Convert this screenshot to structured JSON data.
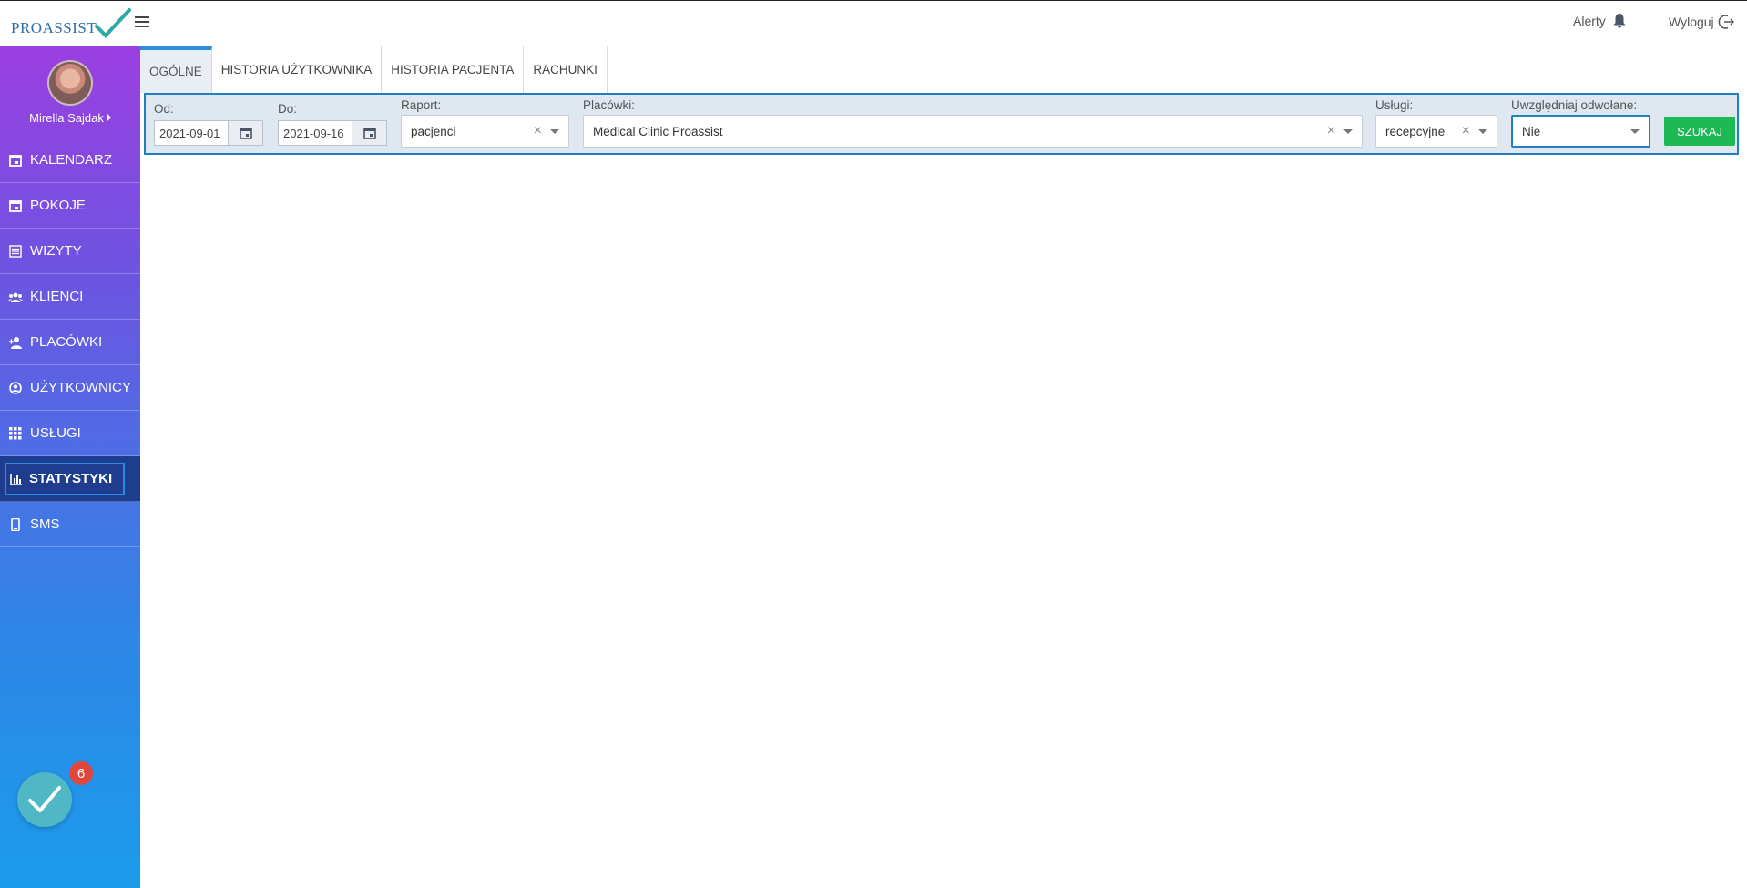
{
  "app": {
    "logo_text": "PROASSIST"
  },
  "header": {
    "alerts_label": "Alerty",
    "logout_label": "Wyloguj"
  },
  "user": {
    "name": "Mirella Sajdak"
  },
  "nav": {
    "items": [
      {
        "label": "KALENDARZ",
        "icon": "calendar-icon"
      },
      {
        "label": "POKOJE",
        "icon": "calendar-icon"
      },
      {
        "label": "WIZYTY",
        "icon": "list-icon"
      },
      {
        "label": "KLIENCI",
        "icon": "group-icon"
      },
      {
        "label": "PLACÓWKI",
        "icon": "person-add-icon"
      },
      {
        "label": "UŻYTKOWNICY",
        "icon": "user-circle-icon"
      },
      {
        "label": "USŁUGI",
        "icon": "grid-icon"
      },
      {
        "label": "STATYSTYKI",
        "icon": "bar-chart-icon",
        "active": true
      },
      {
        "label": "SMS",
        "icon": "phone-icon"
      }
    ]
  },
  "chat": {
    "badge_count": "6"
  },
  "tabs": [
    {
      "label": "OGÓLNE",
      "active": true
    },
    {
      "label": "HISTORIA UŻYTKOWNIKA"
    },
    {
      "label": "HISTORIA PACJENTA"
    },
    {
      "label": "RACHUNKI"
    }
  ],
  "filters": {
    "from_label": "Od:",
    "from_value": "2021-09-01",
    "to_label": "Do:",
    "to_value": "2021-09-16",
    "report_label": "Raport:",
    "report_value": "pacjenci",
    "facilities_label": "Placówki:",
    "facilities_value": "Medical Clinic Proassist",
    "services_label": "Usługi:",
    "services_value": "recepcyjne",
    "cancelled_label": "Uwzględniaj odwołane:",
    "cancelled_value": "Nie",
    "search_label": "SZUKAJ"
  },
  "colors": {
    "accent": "#1f7fc0",
    "search_button": "#1db954",
    "badge": "#e0463c"
  }
}
